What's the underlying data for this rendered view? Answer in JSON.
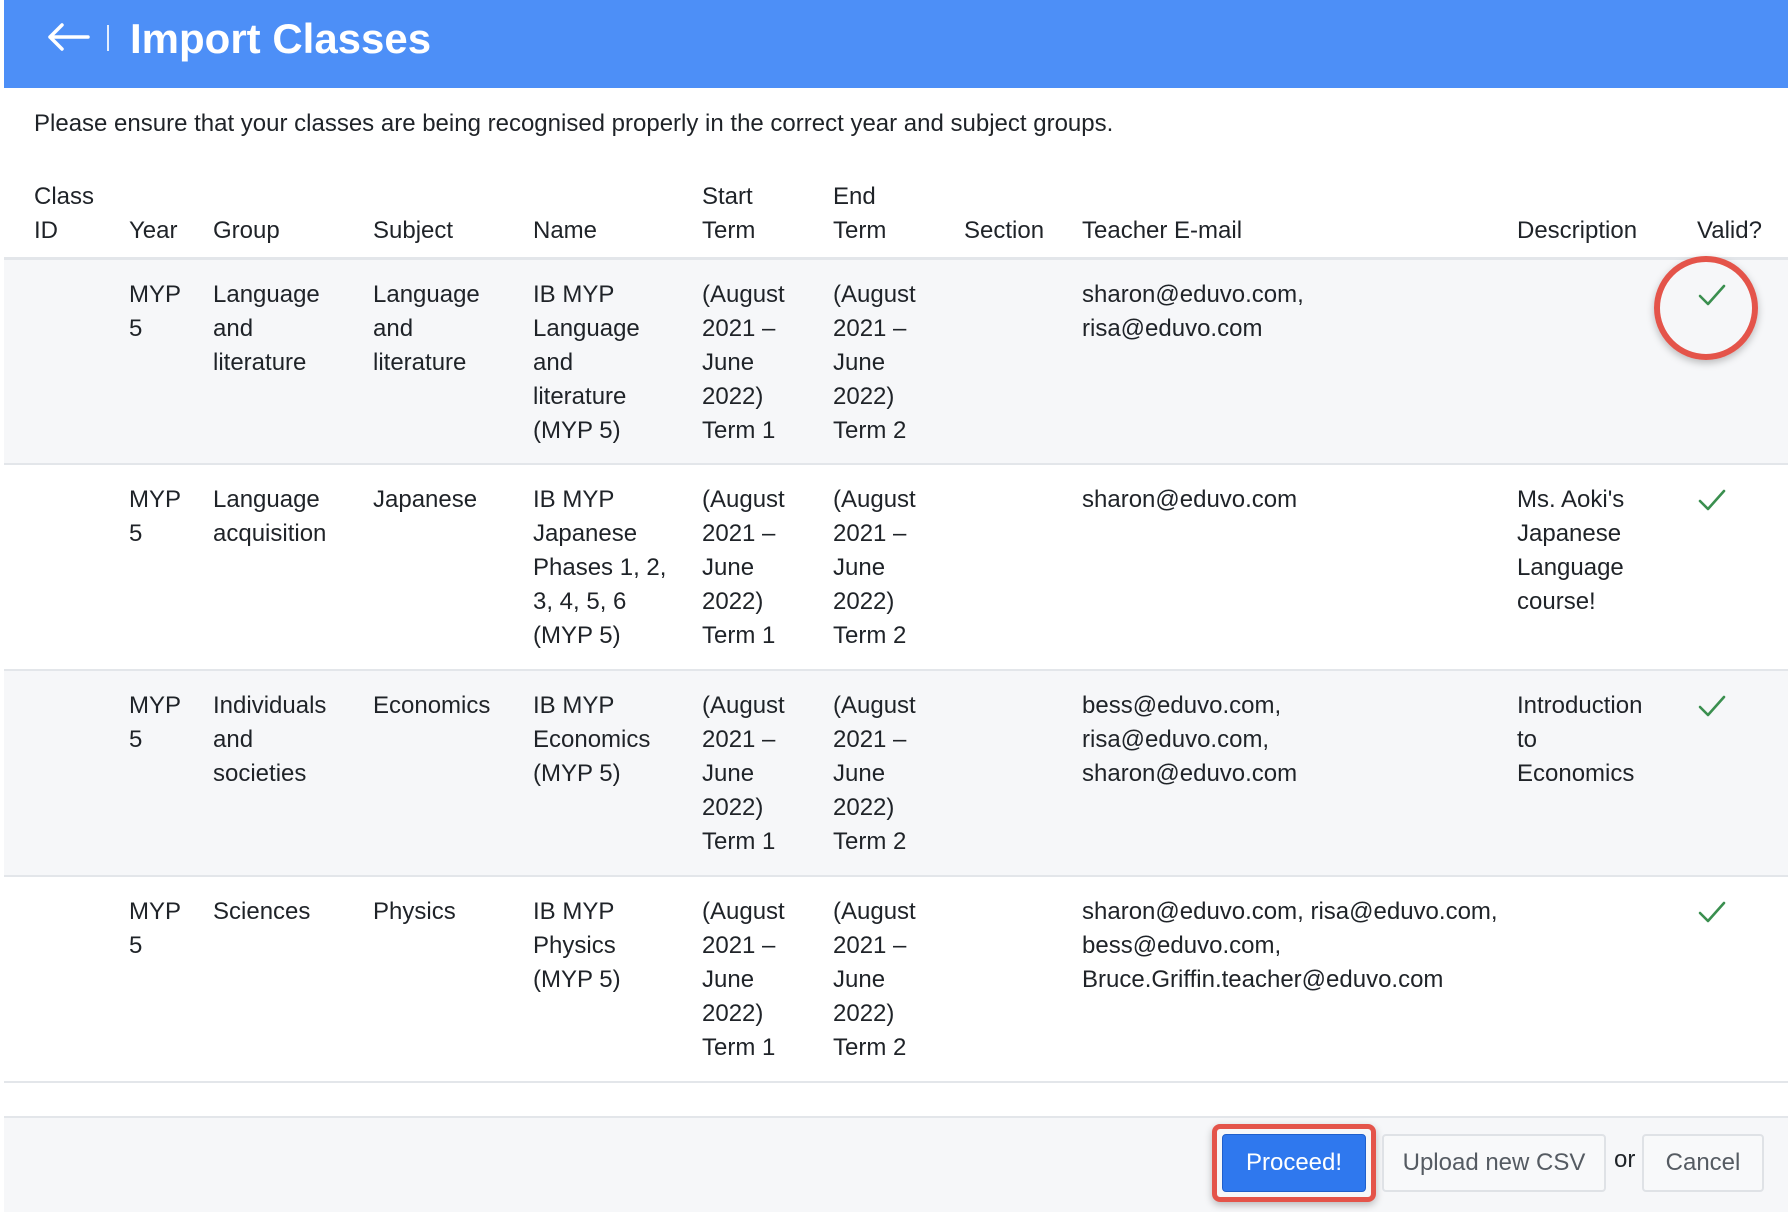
{
  "header": {
    "title": "Import Classes",
    "back_icon": "arrow-left-icon",
    "background_color": "#4d8ff7"
  },
  "intro_text": "Please ensure that your classes are being recognised properly in the correct year and subject groups.",
  "table": {
    "columns": [
      {
        "key": "class_id",
        "line1": "Class",
        "line2": "ID"
      },
      {
        "key": "year",
        "line1": "",
        "line2": "Year"
      },
      {
        "key": "group",
        "line1": "",
        "line2": "Group"
      },
      {
        "key": "subject",
        "line1": "",
        "line2": "Subject"
      },
      {
        "key": "name",
        "line1": "",
        "line2": "Name"
      },
      {
        "key": "start_term",
        "line1": "Start",
        "line2": "Term"
      },
      {
        "key": "end_term",
        "line1": "End",
        "line2": "Term"
      },
      {
        "key": "section",
        "line1": "",
        "line2": "Section"
      },
      {
        "key": "teacher_email",
        "line1": "",
        "line2": "Teacher E-mail"
      },
      {
        "key": "description",
        "line1": "",
        "line2": "Description"
      },
      {
        "key": "valid",
        "line1": "",
        "line2": "Valid?"
      }
    ],
    "rows": [
      {
        "class_id": "",
        "year": "MYP 5",
        "group": "Language and literature",
        "subject": "Language and literature",
        "name": "IB MYP Language and literature (MYP 5)",
        "start_term": "(August 2021 – June 2022) Term 1",
        "end_term": "(August 2021 – June 2022) Term 2",
        "section": "",
        "teacher_email": "sharon@eduvo.com, risa@eduvo.com",
        "description": "",
        "valid": "check-icon"
      },
      {
        "class_id": "",
        "year": "MYP 5",
        "group": "Language acquisition",
        "subject": "Japanese",
        "name": "IB MYP Japanese Phases 1, 2, 3, 4, 5, 6 (MYP 5)",
        "start_term": "(August 2021 – June 2022) Term 1",
        "end_term": "(August 2021 – June 2022) Term 2",
        "section": "",
        "teacher_email": "sharon@eduvo.com",
        "description": "Ms. Aoki's Japanese Language course!",
        "valid": "check-icon"
      },
      {
        "class_id": "",
        "year": "MYP 5",
        "group": "Individuals and societies",
        "subject": "Economics",
        "name": "IB MYP Economics (MYP 5)",
        "start_term": "(August 2021 – June 2022) Term 1",
        "end_term": "(August 2021 – June 2022) Term 2",
        "section": "",
        "teacher_email": "bess@eduvo.com, risa@eduvo.com, sharon@eduvo.com",
        "description": "Introduction to Economics",
        "valid": "check-icon"
      },
      {
        "class_id": "",
        "year": "MYP 5",
        "group": "Sciences",
        "subject": "Physics",
        "name": "IB MYP Physics (MYP 5)",
        "start_term": "(August 2021 – June 2022) Term 1",
        "end_term": "(August 2021 – June 2022) Term 2",
        "section": "",
        "teacher_email": "sharon@eduvo.com, risa@eduvo.com, bess@eduvo.com, Bruce.Griffin.teacher@eduvo.com",
        "description": "",
        "valid": "check-icon"
      }
    ]
  },
  "footer": {
    "proceed_label": "Proceed!",
    "upload_label": "Upload new CSV",
    "or_label": "or",
    "cancel_label": "Cancel"
  },
  "colors": {
    "primary": "#2f78ee",
    "check": "#3a8f4f",
    "highlight": "#e4544a"
  }
}
